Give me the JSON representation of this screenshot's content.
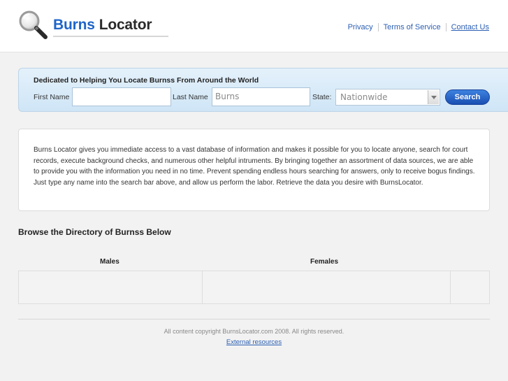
{
  "header": {
    "logo_word1": "Burns",
    "logo_word2": "Locator",
    "links": [
      "Privacy",
      "Terms of Service",
      "Contact Us"
    ]
  },
  "search": {
    "tagline": "Dedicated to Helping You Locate Burnss From Around the World",
    "first_name_label": "First Name",
    "first_name_value": "",
    "last_name_label": "Last Name",
    "last_name_value": "Burns",
    "state_label": "State:",
    "state_selected": "Nationwide",
    "button_label": "Search"
  },
  "info": {
    "text": "Burns Locator gives you immediate access to a vast database of information and makes it possible for you to locate anyone, search for court records, execute background checks, and numerous other helpful intruments. By bringing together an assortment of data sources, we are able to provide you with the information you need in no time. Prevent spending endless hours searching for answers, only to receive bogus findings. Just type any name into the search bar above, and allow us perform the labor. Retrieve the data you desire with BurnsLocator."
  },
  "directory": {
    "title": "Browse the Directory of Burnss Below",
    "columns": [
      "Males",
      "Females"
    ]
  },
  "footer": {
    "copyright": "All content copyright BurnsLocator.com 2008. All rights reserved.",
    "external_link": "External resources"
  },
  "colors": {
    "brand_blue": "#1f65c8",
    "button_blue": "#1a4fb2",
    "link_blue": "#2b5fb3"
  }
}
